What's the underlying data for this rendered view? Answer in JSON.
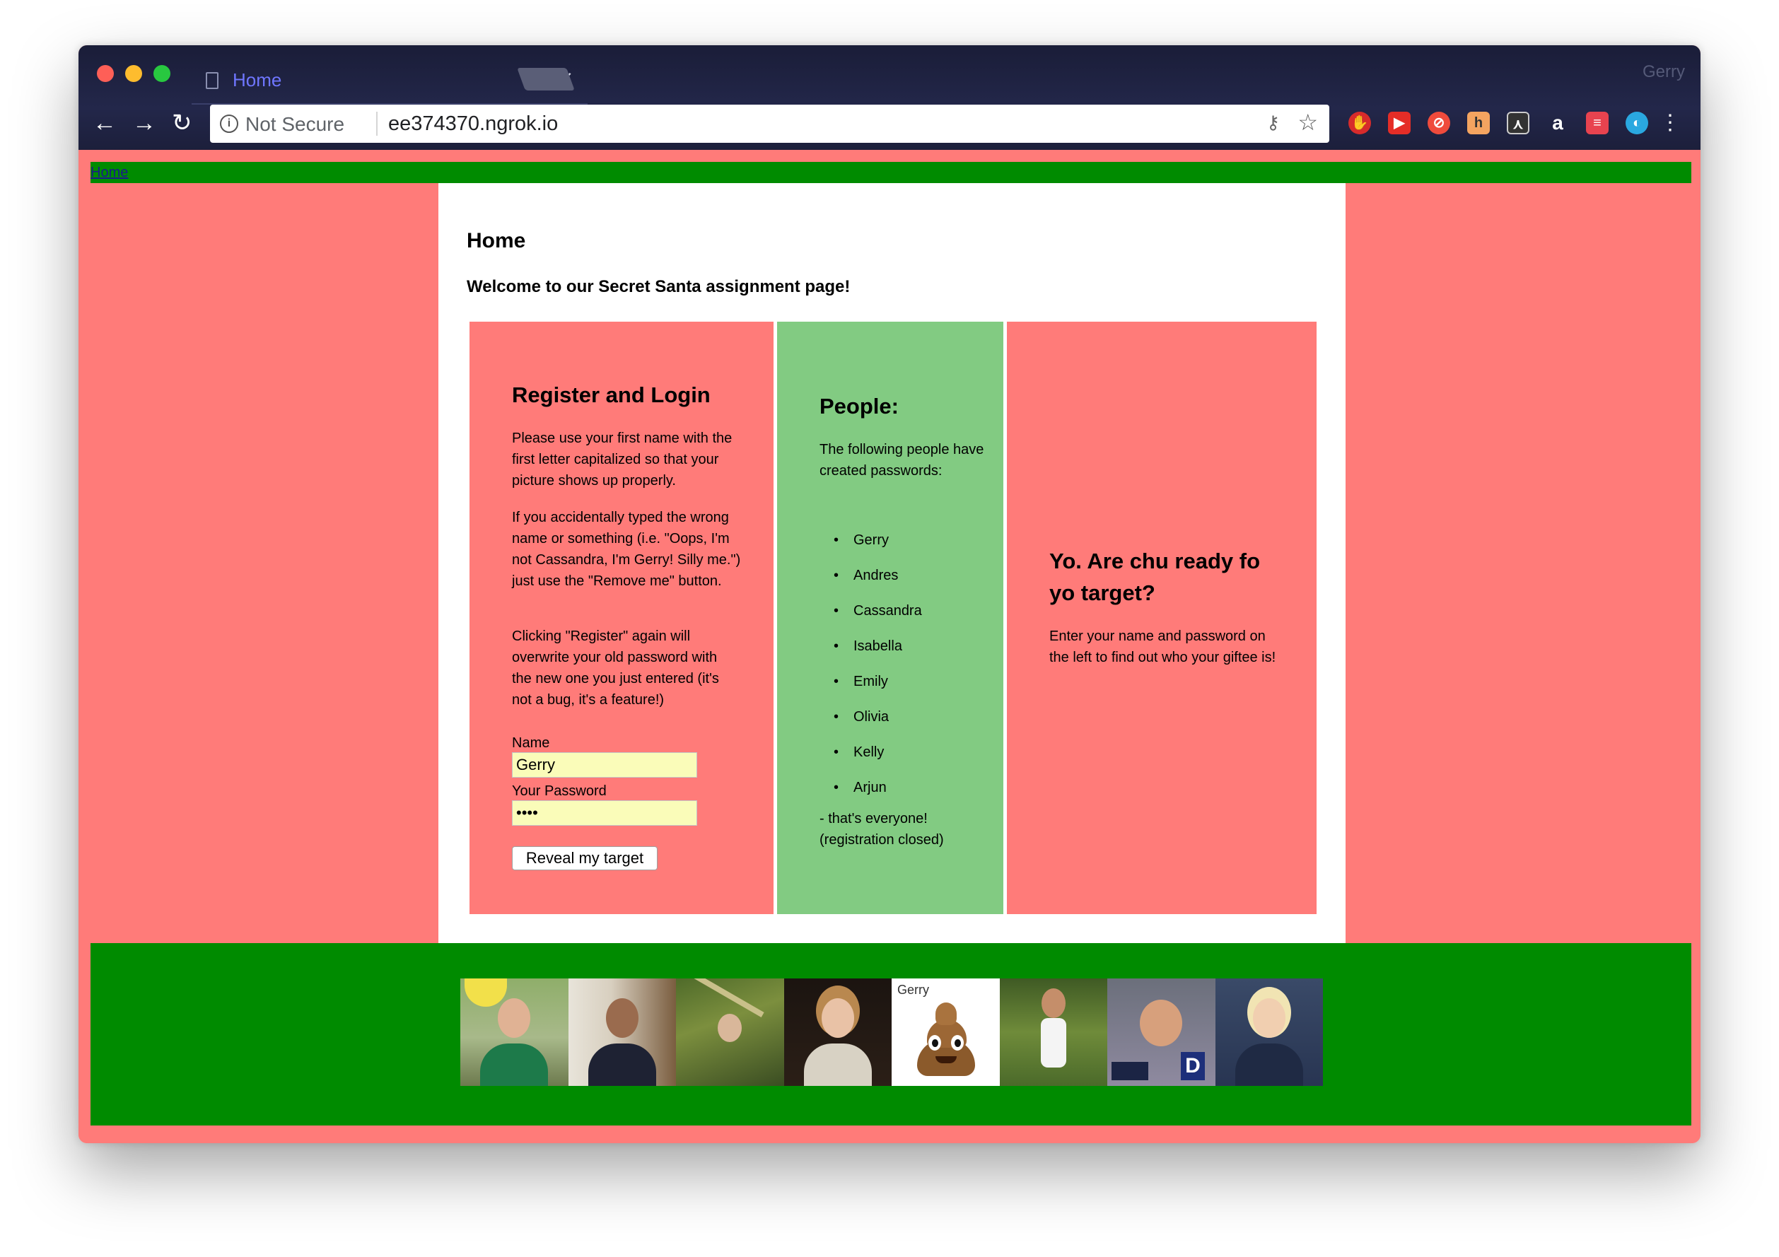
{
  "browser": {
    "tab_title": "Home",
    "profile_name": "Gerry",
    "security_label": "Not Secure",
    "url": "ee374370.ngrok.io",
    "extensions": [
      "adblock-icon",
      "youtube-icon",
      "no-tracking-icon",
      "honey-icon",
      "reader-icon",
      "amazon-icon",
      "stack-icon",
      "chrome-remote-icon"
    ]
  },
  "nav": {
    "home_link": "Home"
  },
  "page": {
    "title": "Home",
    "welcome": "Welcome to our Secret Santa assignment page!"
  },
  "register": {
    "title": "Register and Login",
    "para1": "Please use your first name with the first letter capitalized so that your picture shows up properly.",
    "para2": "If you accidentally typed the wrong name or something (i.e. \"Oops, I'm not Cassandra, I'm Gerry! Silly me.\") just use the \"Remove me\" button.",
    "para3": "Clicking \"Register\" again will overwrite your old password with the new one you just entered (it's not a bug, it's a feature!)",
    "name_label": "Name",
    "name_value": "Gerry",
    "password_label": "Your Password",
    "password_value": "••••",
    "submit_label": "Reveal my target"
  },
  "people": {
    "title": "People:",
    "intro": "The following people have created passwords:",
    "names": [
      "Gerry",
      "Andres",
      "Cassandra",
      "Isabella",
      "Emily",
      "Olivia",
      "Kelly",
      "Arjun"
    ],
    "outro": "- that's everyone! (registration closed)"
  },
  "target": {
    "title": "Yo. Are chu ready fo yo target?",
    "text": "Enter your name and password on the left to find out who your giftee is!"
  },
  "photos": {
    "poo_label": "Gerry"
  },
  "colors": {
    "page_bg": "#ff7b79",
    "green_bar": "#008b00",
    "people_col": "#82cb82",
    "input_bg": "#fafcb9"
  }
}
